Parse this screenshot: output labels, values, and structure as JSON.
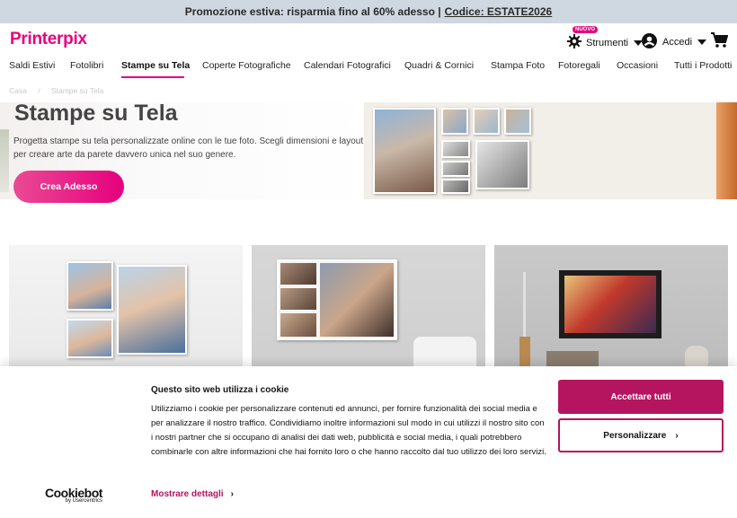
{
  "promo": {
    "text": "Promozione estiva: risparmia fino al 60% adesso |",
    "code": "Codice: ESTATE2026"
  },
  "header": {
    "logo": "Printerpix",
    "tools_label": "Strumenti",
    "new_badge": "NUOVO",
    "login_label": "Accedi"
  },
  "nav": {
    "items": [
      "Saldi Estivi",
      "Fotolibri",
      "Stampe su Tela",
      "Coperte Fotografiche",
      "Calendari Fotografici",
      "Quadri & Cornici",
      "Stampa Foto",
      "Fotoregali",
      "Occasioni",
      "Tutti i Prodotti"
    ],
    "active": "Stampe su Tela"
  },
  "breadcrumb": {
    "home": "Casa",
    "separator": "/",
    "current": "Stampe su Tela"
  },
  "hero": {
    "title": "Stampe su Tela",
    "description": "Progetta stampe su tela personalizzate online con le tue foto. Scegli dimensioni e layout per creare arte da parete davvero unica nel suo genere.",
    "cta": "Crea Adesso"
  },
  "cookie": {
    "title": "Questo sito web utilizza i cookie",
    "text": "Utilizziamo i cookie per personalizzare contenuti ed annunci, per fornire funzionalità dei social media e per analizzare il nostro traffico. Condividiamo inoltre informazioni sul modo in cui utilizzi il nostro sito con i nostri partner che si occupano di analisi dei dati web, pubblicità e social media, i quali potrebbero combinarle con altre informazioni che hai fornito loro o che hanno raccolto dal tuo utilizzo dei loro servizi.",
    "accept": "Accettare tutti",
    "customize": "Personalizzare",
    "details": "Mostrare dettagli",
    "brand": "Cookiebot",
    "brand_sub": "by Usercentrics"
  },
  "colors": {
    "brand": "#e6007e",
    "cookie_accent": "#b5145f",
    "promo_bg": "#cfd8e0"
  },
  "icons": [
    "gear-icon",
    "user-icon",
    "cart-icon",
    "caret-down-icon",
    "chevron-right-icon"
  ]
}
